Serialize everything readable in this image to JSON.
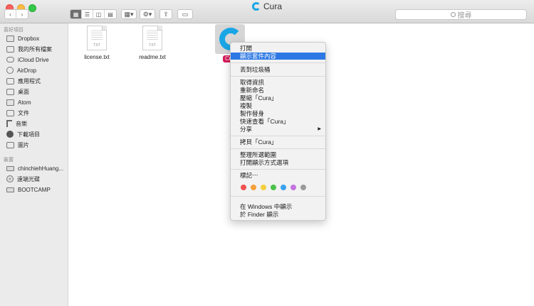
{
  "window": {
    "title": "Cura"
  },
  "toolbar": {
    "back_icon": "chevron-left-icon",
    "forward_icon": "chevron-right-icon",
    "view_icons": [
      "icon-view-icon",
      "list-view-icon",
      "column-view-icon",
      "gallery-view-icon"
    ],
    "group_icon": "group-icon",
    "action_icon": "gear-icon",
    "share_icon": "share-icon",
    "tag_icon": "tag-icon",
    "search_placeholder": "搜尋"
  },
  "sidebar": {
    "favorites_header": "喜好項目",
    "favorites": [
      {
        "label": "Dropbox",
        "icon": "folder-icon"
      },
      {
        "label": "我的所有檔案",
        "icon": "all-files-icon"
      },
      {
        "label": "iCloud Drive",
        "icon": "cloud-icon"
      },
      {
        "label": "AirDrop",
        "icon": "airdrop-icon"
      },
      {
        "label": "應用程式",
        "icon": "applications-icon"
      },
      {
        "label": "桌面",
        "icon": "desktop-icon"
      },
      {
        "label": "Atom",
        "icon": "folder-icon"
      },
      {
        "label": "文件",
        "icon": "documents-icon"
      },
      {
        "label": "音樂",
        "icon": "music-icon"
      },
      {
        "label": "下載項目",
        "icon": "download-icon"
      },
      {
        "label": "圖片",
        "icon": "pictures-icon"
      }
    ],
    "devices_header": "裝置",
    "devices": [
      {
        "label": "chinchiehHuang...",
        "icon": "laptop-icon"
      },
      {
        "label": "遠端光碟",
        "icon": "disc-icon"
      },
      {
        "label": "BOOTCAMP",
        "icon": "drive-icon"
      }
    ]
  },
  "files": [
    {
      "name": "license.txt",
      "ext": "TXT"
    },
    {
      "name": "readme.txt",
      "ext": "TXT"
    }
  ],
  "selected_item": {
    "label": "Cu",
    "icon": "cura-app-icon"
  },
  "context_menu": {
    "items": [
      "打開",
      "顯示套件內容",
      "丟到垃圾桶",
      "取得資訊",
      "重新命名",
      "壓縮「Cura」",
      "複製",
      "製作替身",
      "快速查看「Cura」",
      "分享",
      "拷貝「Cura」",
      "整理所選範圍",
      "打開顯示方式選項",
      "標記⋯",
      "在 Windows 中顯示",
      "於 Finder 顯示"
    ],
    "highlighted": "顯示套件內容",
    "share_arrow": "▶",
    "tag_colors": [
      "#f0534e",
      "#f5a03a",
      "#f4cf3f",
      "#4cc14a",
      "#3aa2ef",
      "#c474e0",
      "#9a9a9a"
    ]
  }
}
